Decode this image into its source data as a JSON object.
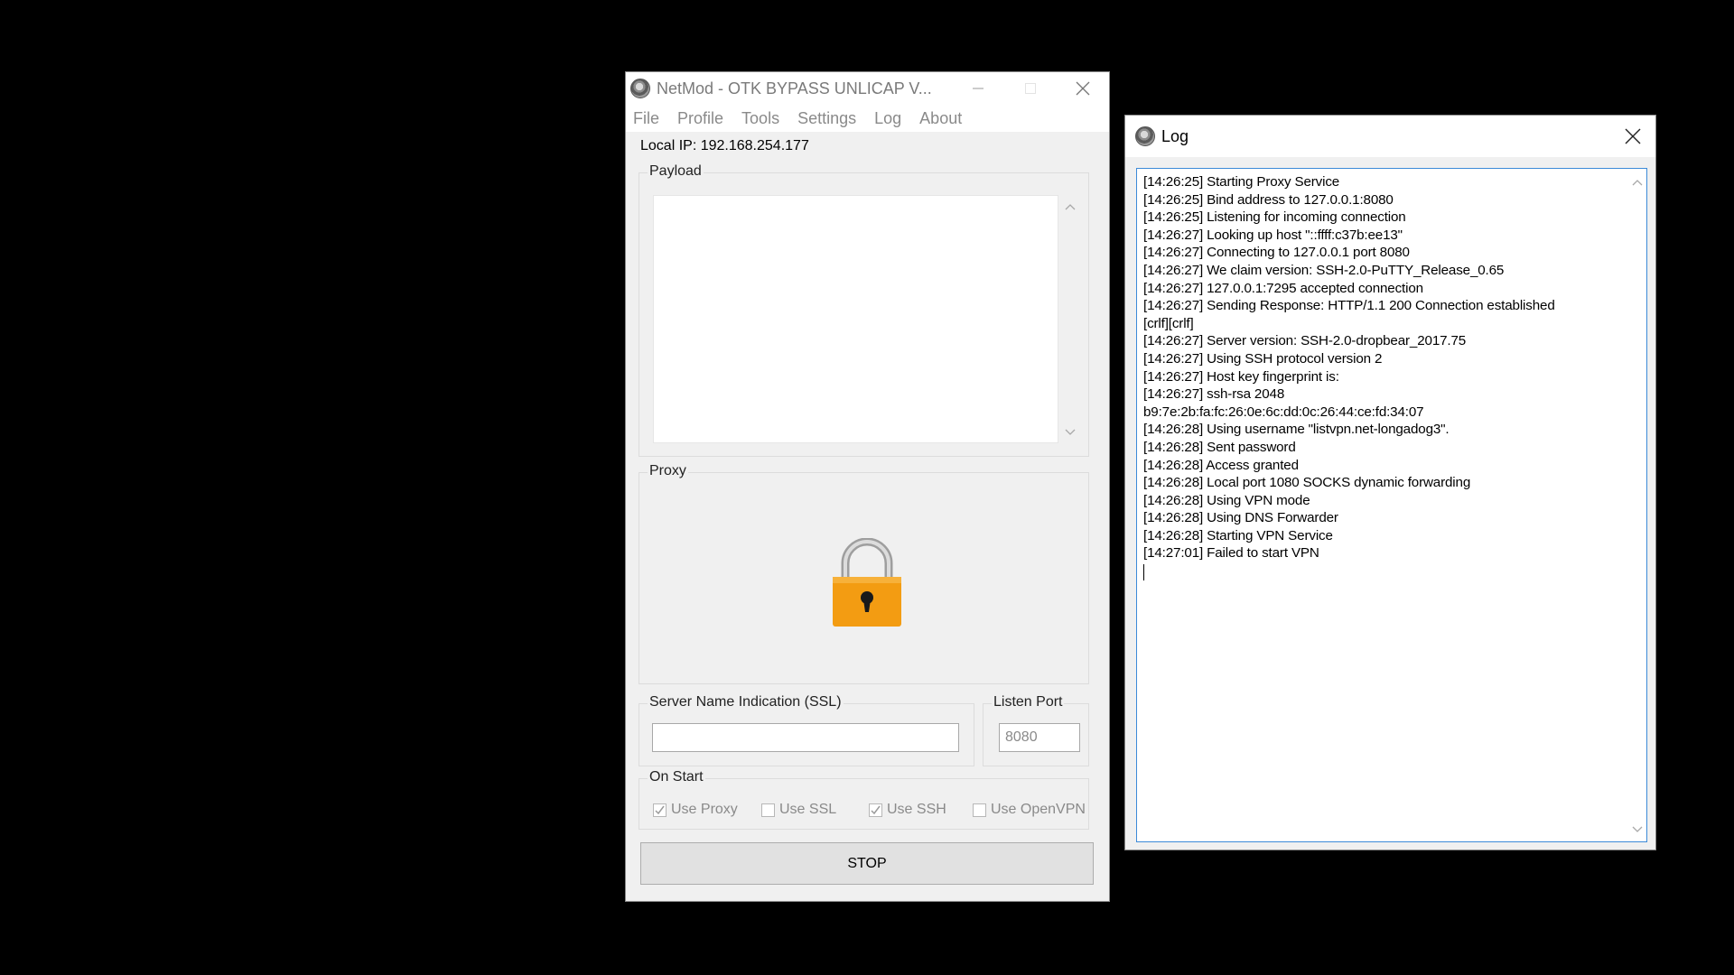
{
  "main_window": {
    "title": "NetMod - OTK BYPASS UNLICAP V...",
    "menu": [
      "File",
      "Profile",
      "Tools",
      "Settings",
      "Log",
      "About"
    ],
    "local_ip_label": "Local IP:",
    "local_ip_value": "192.168.254.177",
    "payload_label": "Payload",
    "payload_value": "",
    "proxy_label": "Proxy",
    "sni_label": "Server Name Indication (SSL)",
    "sni_value": "",
    "listen_port_label": "Listen Port",
    "listen_port_value": "8080",
    "on_start_label": "On Start",
    "checkboxes": [
      {
        "label": "Use Proxy",
        "checked": true
      },
      {
        "label": "Use SSL",
        "checked": false
      },
      {
        "label": "Use SSH",
        "checked": true
      },
      {
        "label": "Use OpenVPN",
        "checked": false
      }
    ],
    "stop_label": "STOP",
    "lock_icon": "padlock-icon",
    "lock_color": "#f39c12"
  },
  "log_window": {
    "title": "Log",
    "lines": [
      "[14:26:25] Starting Proxy Service",
      "[14:26:25] Bind address to 127.0.0.1:8080",
      "[14:26:25] Listening for incoming connection",
      "[14:26:27] Looking up host \"::ffff:c37b:ee13\"",
      "[14:26:27] Connecting to 127.0.0.1 port 8080",
      "[14:26:27] We claim version: SSH-2.0-PuTTY_Release_0.65",
      "[14:26:27] 127.0.0.1:7295 accepted connection",
      "[14:26:27] Sending Response: HTTP/1.1 200 Connection established",
      "[crlf][crlf]",
      "[14:26:27] Server version: SSH-2.0-dropbear_2017.75",
      "[14:26:27] Using SSH protocol version 2",
      "[14:26:27] Host key fingerprint is:",
      "[14:26:27] ssh-rsa 2048",
      "b9:7e:2b:fa:fc:26:0e:6c:dd:0c:26:44:ce:fd:34:07",
      "[14:26:28] Using username \"listvpn.net-longadog3\".",
      "[14:26:28] Sent password",
      "[14:26:28] Access granted",
      "[14:26:28] Local port 1080 SOCKS dynamic forwarding",
      "[14:26:28] Using VPN mode",
      "[14:26:28] Using DNS Forwarder",
      "[14:26:28] Starting VPN Service",
      "[14:27:01] Failed to start VPN"
    ]
  }
}
